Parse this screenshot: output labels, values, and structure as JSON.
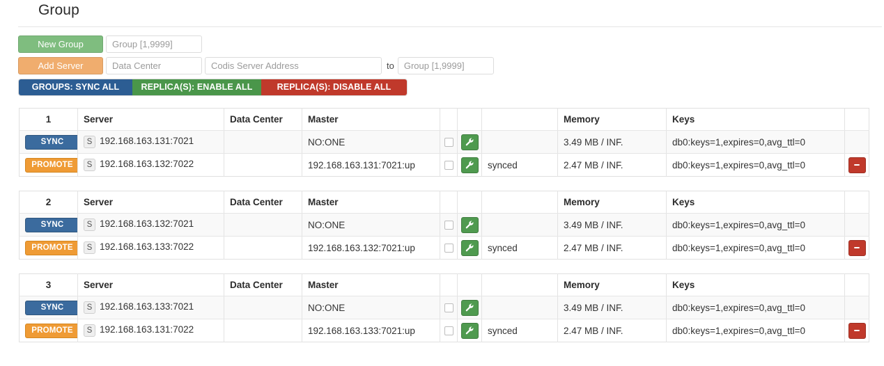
{
  "header": {
    "title": "Group"
  },
  "toolbar": {
    "new_group_label": "New Group",
    "new_group_placeholder": "Group [1,9999]",
    "add_server_label": "Add Server",
    "data_center_placeholder": "Data Center",
    "server_address_placeholder": "Codis Server Address",
    "to_label": "to",
    "to_group_placeholder": "Group [1,9999]",
    "new_group_value": "",
    "data_center_value": "",
    "server_address_value": "",
    "to_group_value": "",
    "colors": {
      "new_group": "#7fbd7f",
      "add_server": "#f0ad6e"
    }
  },
  "action_bar": {
    "buttons": [
      {
        "label": "GROUPS: SYNC ALL",
        "color": "#2c5d93"
      },
      {
        "label": "REPLICA(S): ENABLE ALL",
        "color": "#4a964a"
      },
      {
        "label": "REPLICA(S): DISABLE ALL",
        "color": "#c0392b"
      }
    ]
  },
  "table_headers": {
    "server": "Server",
    "data_center": "Data Center",
    "master": "Master",
    "memory": "Memory",
    "keys": "Keys",
    "blank1": "",
    "blank2": "",
    "blank3": "",
    "blank4": ""
  },
  "groups": [
    {
      "id": "1",
      "rows": [
        {
          "action_label": "SYNC",
          "action_kind": "sync",
          "server_badge": "S",
          "server": "192.168.163.131:7021",
          "data_center": "",
          "master": "NO:ONE",
          "status": "",
          "memory": "3.49 MB / INF.",
          "keys": "db0:keys=1,expires=0,avg_ttl=0",
          "has_delete": false
        },
        {
          "action_label": "PROMOTE",
          "action_kind": "promote",
          "server_badge": "S",
          "server": "192.168.163.132:7022",
          "data_center": "",
          "master": "192.168.163.131:7021:up",
          "status": "synced",
          "memory": "2.47 MB / INF.",
          "keys": "db0:keys=1,expires=0,avg_ttl=0",
          "has_delete": true
        }
      ]
    },
    {
      "id": "2",
      "rows": [
        {
          "action_label": "SYNC",
          "action_kind": "sync",
          "server_badge": "S",
          "server": "192.168.163.132:7021",
          "data_center": "",
          "master": "NO:ONE",
          "status": "",
          "memory": "3.49 MB / INF.",
          "keys": "db0:keys=1,expires=0,avg_ttl=0",
          "has_delete": false
        },
        {
          "action_label": "PROMOTE",
          "action_kind": "promote",
          "server_badge": "S",
          "server": "192.168.163.133:7022",
          "data_center": "",
          "master": "192.168.163.132:7021:up",
          "status": "synced",
          "memory": "2.47 MB / INF.",
          "keys": "db0:keys=1,expires=0,avg_ttl=0",
          "has_delete": true
        }
      ]
    },
    {
      "id": "3",
      "rows": [
        {
          "action_label": "SYNC",
          "action_kind": "sync",
          "server_badge": "S",
          "server": "192.168.163.133:7021",
          "data_center": "",
          "master": "NO:ONE",
          "status": "",
          "memory": "3.49 MB / INF.",
          "keys": "db0:keys=1,expires=0,avg_ttl=0",
          "has_delete": false
        },
        {
          "action_label": "PROMOTE",
          "action_kind": "promote",
          "server_badge": "S",
          "server": "192.168.163.131:7022",
          "data_center": "",
          "master": "192.168.163.133:7021:up",
          "status": "synced",
          "memory": "2.47 MB / INF.",
          "keys": "db0:keys=1,expires=0,avg_ttl=0",
          "has_delete": true
        }
      ]
    }
  ],
  "icons": {
    "wrench": "wrench-icon",
    "minus": "minus-icon",
    "checkbox": "checkbox-icon"
  }
}
